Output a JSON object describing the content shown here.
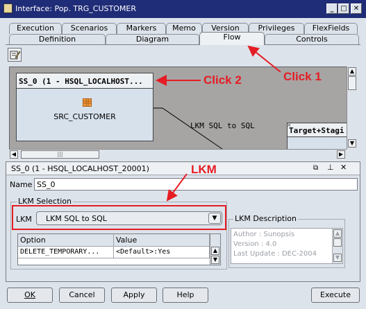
{
  "window": {
    "title": "Interface: Pop. TRG_CUSTOMER",
    "buttons": [
      "_",
      "□",
      "✕"
    ]
  },
  "tabs": {
    "row_back": [
      "Execution",
      "Scenarios",
      "Markers",
      "Memo",
      "Version",
      "Privileges",
      "FlexFields"
    ],
    "row_front": [
      "Definition",
      "Diagram",
      "Flow",
      "Controls"
    ],
    "active": "Flow"
  },
  "diagram": {
    "source_header": "SS_0 (1 - HSQL_LOCALHOST...",
    "source_table": "SRC_CUSTOMER",
    "link_label": "LKM SQL to SQL",
    "target_header": "Target+Stagi",
    "scroll_marks": "|||"
  },
  "annotations": {
    "click1": "Click 1",
    "click2": "Click 2",
    "lkm": "LKM",
    "color": "#e51c23"
  },
  "properties": {
    "title": "SS_0 (1 - HSQL_LOCALHOST_20001)",
    "header_icons": [
      "restore-icon",
      "pin-icon",
      "close-icon"
    ],
    "name_label": "Name",
    "name_value": "SS_0",
    "lkm_selection_legend": "LKM Selection",
    "lkm_label": "LKM",
    "lkm_value": "LKM SQL to SQL",
    "options_headers": [
      "Option",
      "Value"
    ],
    "options_rows": [
      {
        "option": "DELETE_TEMPORARY...",
        "value": "<Default>:Yes"
      }
    ],
    "description_legend": "LKM Description",
    "description_lines": [
      "Author : Sunopsis",
      "Version : 4.0",
      "Last Update : DEC-2004"
    ]
  },
  "buttons": {
    "ok": "OK",
    "cancel": "Cancel",
    "apply": "Apply",
    "help": "Help",
    "execute": "Execute"
  }
}
